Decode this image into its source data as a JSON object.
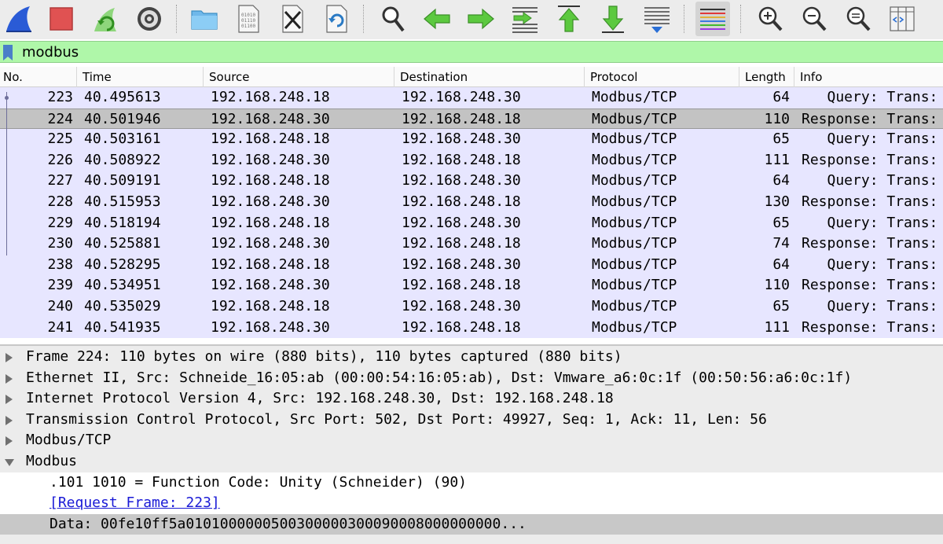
{
  "toolbar": {
    "buttons": [
      {
        "name": "start-capture",
        "icon": "shark-fin-icon"
      },
      {
        "name": "stop-capture",
        "icon": "stop-square-icon"
      },
      {
        "name": "restart-capture",
        "icon": "restart-fin-icon"
      },
      {
        "name": "capture-options",
        "icon": "gear-icon"
      },
      {
        "name": "open-file",
        "icon": "folder-icon"
      },
      {
        "name": "save-file",
        "icon": "binary-file-icon"
      },
      {
        "name": "close-file",
        "icon": "close-file-icon"
      },
      {
        "name": "reload-file",
        "icon": "reload-file-icon"
      },
      {
        "name": "find-packet",
        "icon": "magnifier-icon"
      },
      {
        "name": "go-back",
        "icon": "arrow-left-icon"
      },
      {
        "name": "go-forward",
        "icon": "arrow-right-icon"
      },
      {
        "name": "go-to-packet",
        "icon": "go-to-packet-icon"
      },
      {
        "name": "go-first",
        "icon": "arrow-up-icon"
      },
      {
        "name": "go-last",
        "icon": "arrow-down-icon"
      },
      {
        "name": "auto-scroll",
        "icon": "auto-scroll-icon"
      },
      {
        "name": "colorize",
        "icon": "colorize-lines-icon"
      },
      {
        "name": "zoom-in",
        "icon": "zoom-in-icon"
      },
      {
        "name": "zoom-out",
        "icon": "zoom-out-icon"
      },
      {
        "name": "zoom-normal",
        "icon": "zoom-normal-icon"
      },
      {
        "name": "resize-columns",
        "icon": "resize-columns-icon"
      }
    ],
    "colors": {
      "accent_green": "#44b82f",
      "stop_red": "#e05252",
      "fin_blue": "#2a5bd6"
    }
  },
  "filter": {
    "value": "modbus",
    "bg_color": "#aff7a9"
  },
  "packet_list": {
    "columns": [
      "No.",
      "Time",
      "Source",
      "Destination",
      "Protocol",
      "Length",
      "Info"
    ],
    "row_color": "#e7e6ff",
    "rows": [
      {
        "no": "223",
        "time": "40.495613",
        "src": "192.168.248.18",
        "dst": "192.168.248.30",
        "proto": "Modbus/TCP",
        "len": "64",
        "info": "   Query: Trans:"
      },
      {
        "no": "224",
        "time": "40.501946",
        "src": "192.168.248.30",
        "dst": "192.168.248.18",
        "proto": "Modbus/TCP",
        "len": "110",
        "info": "Response: Trans:"
      },
      {
        "no": "225",
        "time": "40.503161",
        "src": "192.168.248.18",
        "dst": "192.168.248.30",
        "proto": "Modbus/TCP",
        "len": "65",
        "info": "   Query: Trans:"
      },
      {
        "no": "226",
        "time": "40.508922",
        "src": "192.168.248.30",
        "dst": "192.168.248.18",
        "proto": "Modbus/TCP",
        "len": "111",
        "info": "Response: Trans:"
      },
      {
        "no": "227",
        "time": "40.509191",
        "src": "192.168.248.18",
        "dst": "192.168.248.30",
        "proto": "Modbus/TCP",
        "len": "64",
        "info": "   Query: Trans:"
      },
      {
        "no": "228",
        "time": "40.515953",
        "src": "192.168.248.30",
        "dst": "192.168.248.18",
        "proto": "Modbus/TCP",
        "len": "130",
        "info": "Response: Trans:"
      },
      {
        "no": "229",
        "time": "40.518194",
        "src": "192.168.248.18",
        "dst": "192.168.248.30",
        "proto": "Modbus/TCP",
        "len": "65",
        "info": "   Query: Trans:"
      },
      {
        "no": "230",
        "time": "40.525881",
        "src": "192.168.248.30",
        "dst": "192.168.248.18",
        "proto": "Modbus/TCP",
        "len": "74",
        "info": "Response: Trans:"
      },
      {
        "no": "238",
        "time": "40.528295",
        "src": "192.168.248.18",
        "dst": "192.168.248.30",
        "proto": "Modbus/TCP",
        "len": "64",
        "info": "   Query: Trans:"
      },
      {
        "no": "239",
        "time": "40.534951",
        "src": "192.168.248.30",
        "dst": "192.168.248.18",
        "proto": "Modbus/TCP",
        "len": "110",
        "info": "Response: Trans:"
      },
      {
        "no": "240",
        "time": "40.535029",
        "src": "192.168.248.18",
        "dst": "192.168.248.30",
        "proto": "Modbus/TCP",
        "len": "65",
        "info": "   Query: Trans:"
      },
      {
        "no": "241",
        "time": "40.541935",
        "src": "192.168.248.30",
        "dst": "192.168.248.18",
        "proto": "Modbus/TCP",
        "len": "111",
        "info": "Response: Trans:"
      }
    ],
    "selected_no": "224"
  },
  "details": {
    "items": [
      {
        "text": "Frame 224: 110 bytes on wire (880 bits), 110 bytes captured (880 bits)",
        "expanded": false
      },
      {
        "text": "Ethernet II, Src: Schneide_16:05:ab (00:00:54:16:05:ab), Dst: Vmware_a6:0c:1f (00:50:56:a6:0c:1f)",
        "expanded": false
      },
      {
        "text": "Internet Protocol Version 4, Src: 192.168.248.30, Dst: 192.168.248.18",
        "expanded": false
      },
      {
        "text": "Transmission Control Protocol, Src Port: 502, Dst Port: 49927, Seq: 1, Ack: 11, Len: 56",
        "expanded": false
      },
      {
        "text": "Modbus/TCP",
        "expanded": false
      },
      {
        "text": "Modbus",
        "expanded": true
      }
    ],
    "children": [
      {
        "text": ".101 1010 = Function Code: Unity (Schneider) (90)",
        "link": false,
        "selected": false
      },
      {
        "text": "[Request Frame: 223]",
        "link": true,
        "selected": false
      },
      {
        "text": "Data: 00fe10ff5a0101000000500300000300090008000000000...",
        "link": false,
        "selected": true
      }
    ]
  }
}
